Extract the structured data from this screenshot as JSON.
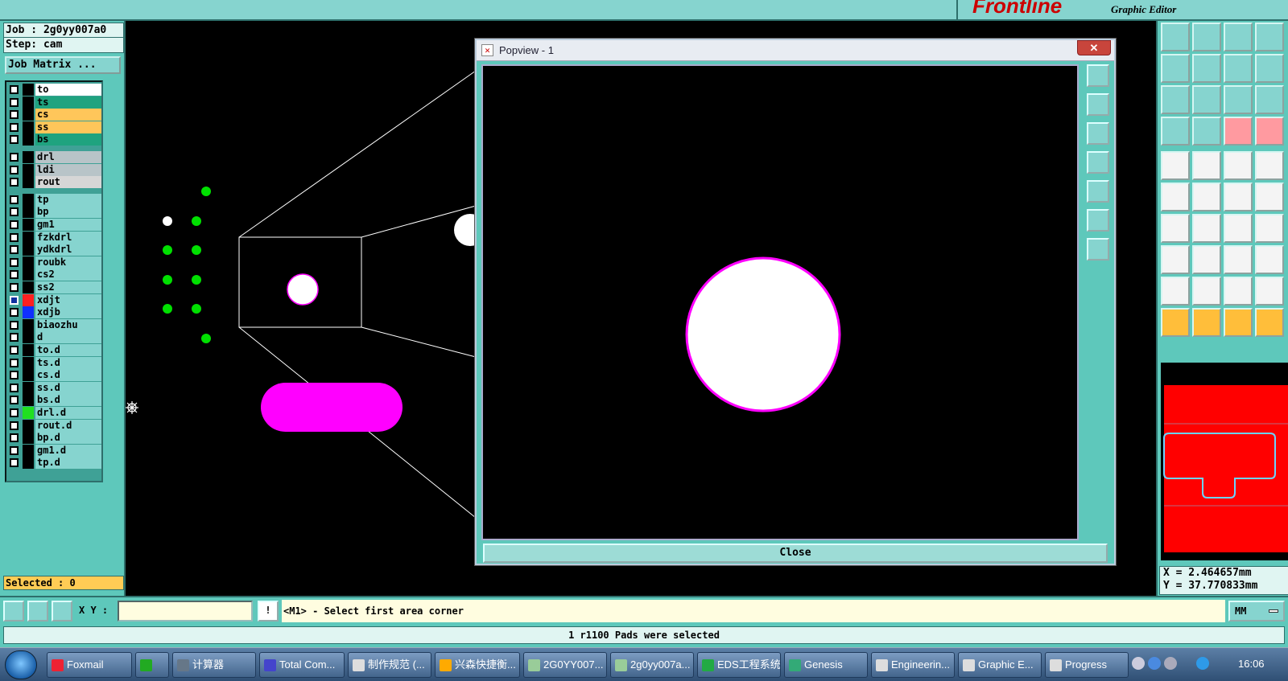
{
  "app": {
    "logo_brand": "Frontline",
    "logo_subtitle": "Graphic Editor"
  },
  "info": {
    "job": "Job : 2g0yy007a0",
    "step": "Step: cam",
    "job_matrix": "Job Matrix ...",
    "selected": "Selected : 0"
  },
  "layers": [
    {
      "name": "to",
      "color": "#ffffff"
    },
    {
      "name": "ts",
      "color": "#1fa37f"
    },
    {
      "name": "cs",
      "color": "#ffc65a"
    },
    {
      "name": "ss",
      "color": "#ffc65a"
    },
    {
      "name": "bs",
      "color": "#1fa37f"
    },
    {
      "name": "drl",
      "color": "#b8c4c8"
    },
    {
      "name": "ldi",
      "color": "#b8c4c8"
    },
    {
      "name": "rout",
      "color": "#d6d6d6"
    },
    {
      "name": "tp",
      "color": "#86d4cf"
    },
    {
      "name": "bp",
      "color": "#86d4cf"
    },
    {
      "name": "gm1",
      "color": "#86d4cf"
    },
    {
      "name": "fzkdrl",
      "color": "#86d4cf"
    },
    {
      "name": "ydkdrl",
      "color": "#86d4cf"
    },
    {
      "name": "roubk",
      "color": "#86d4cf"
    },
    {
      "name": "cs2",
      "color": "#86d4cf"
    },
    {
      "name": "ss2",
      "color": "#86d4cf"
    },
    {
      "name": "xdjt",
      "color": "#86d4cf",
      "swatch": "#ff2020",
      "active": true
    },
    {
      "name": "xdjb",
      "color": "#86d4cf",
      "swatch": "#1030ff"
    },
    {
      "name": "biaozhu",
      "color": "#86d4cf"
    },
    {
      "name": "d",
      "color": "#86d4cf"
    },
    {
      "name": "to.d",
      "color": "#86d4cf"
    },
    {
      "name": "ts.d",
      "color": "#86d4cf"
    },
    {
      "name": "cs.d",
      "color": "#86d4cf"
    },
    {
      "name": "ss.d",
      "color": "#86d4cf"
    },
    {
      "name": "bs.d",
      "color": "#86d4cf"
    },
    {
      "name": "drl.d",
      "color": "#86d4cf",
      "swatch": "#20e020"
    },
    {
      "name": "rout.d",
      "color": "#86d4cf"
    },
    {
      "name": "bp.d",
      "color": "#86d4cf"
    },
    {
      "name": "gm1.d",
      "color": "#86d4cf"
    },
    {
      "name": "tp.d",
      "color": "#86d4cf"
    }
  ],
  "popview": {
    "title": "Popview - 1",
    "close_label": "Close"
  },
  "coords": {
    "x": "X = 2.464657mm",
    "y": "Y = 37.770833mm"
  },
  "command": {
    "xy_label": "X Y :",
    "xy_value": "",
    "excl": "!",
    "prompt": "<M1> - Select first area corner",
    "units": "MM"
  },
  "status": "1 r1100 Pads were selected",
  "taskbar": {
    "items": [
      {
        "label": "Foxmail",
        "color": "#e23"
      },
      {
        "label": "",
        "color": "#2a2"
      },
      {
        "label": "计算器",
        "color": "#678"
      },
      {
        "label": "Total Com...",
        "color": "#44c"
      },
      {
        "label": "制作规范 (...",
        "color": "#ddd"
      },
      {
        "label": "兴森快捷衡...",
        "color": "#fa0"
      },
      {
        "label": "2G0YY007...",
        "color": "#9c9"
      },
      {
        "label": "2g0yy007a...",
        "color": "#9c9"
      },
      {
        "label": "EDS工程系统",
        "color": "#2a4"
      },
      {
        "label": "Genesis",
        "color": "#3a7"
      },
      {
        "label": "Engineerin...",
        "color": "#ddd"
      },
      {
        "label": "Graphic E...",
        "color": "#ddd"
      },
      {
        "label": "Progress",
        "color": "#ddd"
      }
    ],
    "clock": "16:06"
  },
  "colors": {
    "panel": "#5ec8bb",
    "pad_magenta": "#ff00ff",
    "drill_green": "#00e000",
    "minimap_red": "#ff0000"
  }
}
